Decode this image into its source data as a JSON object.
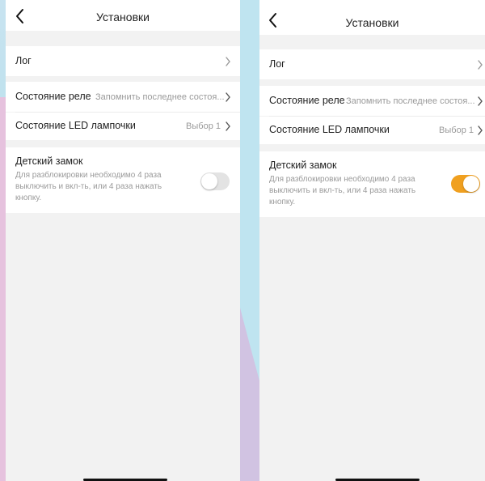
{
  "colors": {
    "toggle_on": "#f0a020",
    "toggle_off": "#e3e3e3",
    "secondary_text": "#9a9a9a",
    "screen_background": "#f2f2f2"
  },
  "screens": [
    {
      "title": "Установки",
      "back_icon": "chevron-left-icon",
      "log_label": "Лог",
      "relay_label": "Состояние реле",
      "relay_value": "Запомнить последнее состоя...",
      "led_label": "Состояние LED лампочки",
      "led_value": "Выбор 1",
      "child_lock_title": "Детский замок",
      "child_lock_desc": "Для разблокировки необходимо 4 раза выключить и вкл-ть, или 4 раза нажать кнопку.",
      "child_lock_enabled": false
    },
    {
      "title": "Установки",
      "back_icon": "chevron-left-icon",
      "log_label": "Лог",
      "relay_label": "Состояние реле",
      "relay_value": "Запомнить последнее состоя...",
      "led_label": "Состояние LED лампочки",
      "led_value": "Выбор 1",
      "child_lock_title": "Детский замок",
      "child_lock_desc": "Для разблокировки необходимо 4 раза выключить и вкл-ть, или 4 раза нажать кнопку.",
      "child_lock_enabled": true
    }
  ]
}
